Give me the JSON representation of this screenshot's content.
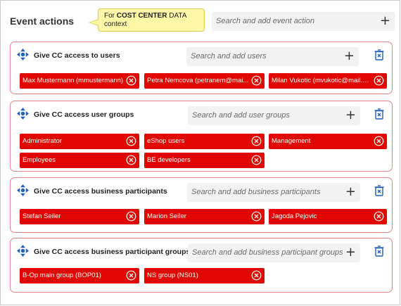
{
  "header": {
    "title": "Event actions",
    "tooltip": {
      "prefix": "For ",
      "bold": "COST CENTER",
      "suffix": " DATA context"
    },
    "search_placeholder": "Search and add event action",
    "add_label": "+"
  },
  "sections": [
    {
      "title": "Give CC access to users",
      "search_placeholder": "Search and add users",
      "add_label": "+",
      "chips": [
        "Max Mustermann (mmustermann)",
        "Petra Nemcova (petranem@mai...",
        "Milan Vukotic (mvukotic@mail.co..."
      ]
    },
    {
      "title": "Give CC access user groups",
      "search_placeholder": "Search and add user groups",
      "add_label": "+",
      "chips": [
        "Administrator",
        "eShop users",
        "Management",
        "Employees",
        "BE developers"
      ]
    },
    {
      "title": "Give CC access business participants",
      "search_placeholder": "Search and add business participants",
      "add_label": "+",
      "chips": [
        "Stefan Seiler",
        "Marion Seiler",
        "Jagoda Pejovic"
      ]
    },
    {
      "title": "Give CC access business participant groups",
      "search_placeholder": "Search and add business participant groups",
      "add_label": "+",
      "chips": [
        "B-Op main group (BOP01)",
        "NS group (NS01)"
      ]
    }
  ],
  "colors": {
    "chip": "#e10600",
    "section_border": "#e28686",
    "icon_blue": "#1f5fbf",
    "tooltip_bg": "#fdf7a6"
  }
}
